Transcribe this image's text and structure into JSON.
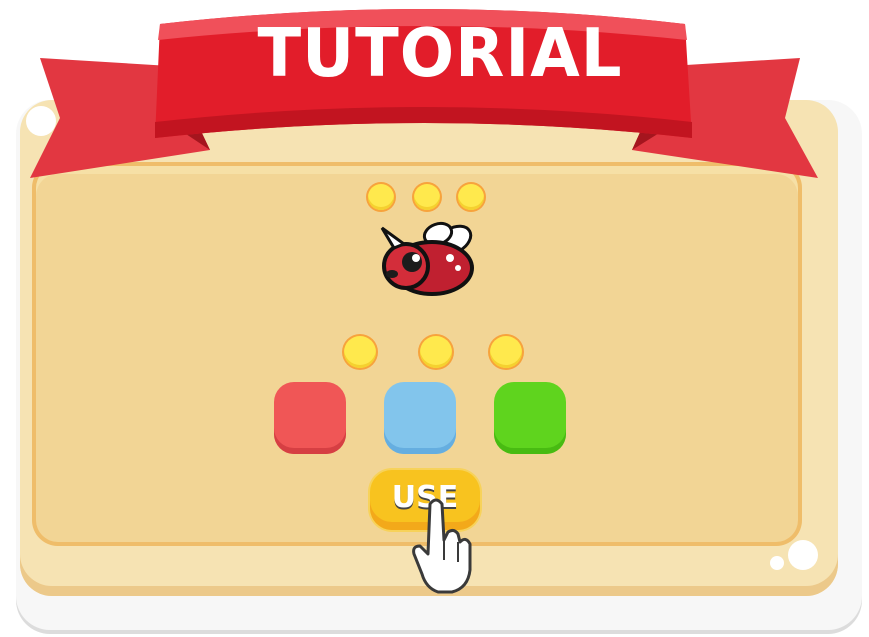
{
  "header": {
    "title": "TUTORIAL"
  },
  "coins": {
    "top_row_count": 3,
    "bottom_row_count": 3
  },
  "color_tiles": [
    {
      "color_name": "red",
      "color": "#f05656"
    },
    {
      "color_name": "blue",
      "color": "#82c5ec"
    },
    {
      "color_name": "green",
      "color": "#5fd41e"
    }
  ],
  "actions": {
    "use_label": "USE"
  },
  "icons": {
    "character": "red-bug-character-icon",
    "pointer": "pointing-hand-icon"
  },
  "colors": {
    "ribbon": "#e21d2a",
    "panel": "#f2d595",
    "button": "#f8c31f"
  }
}
